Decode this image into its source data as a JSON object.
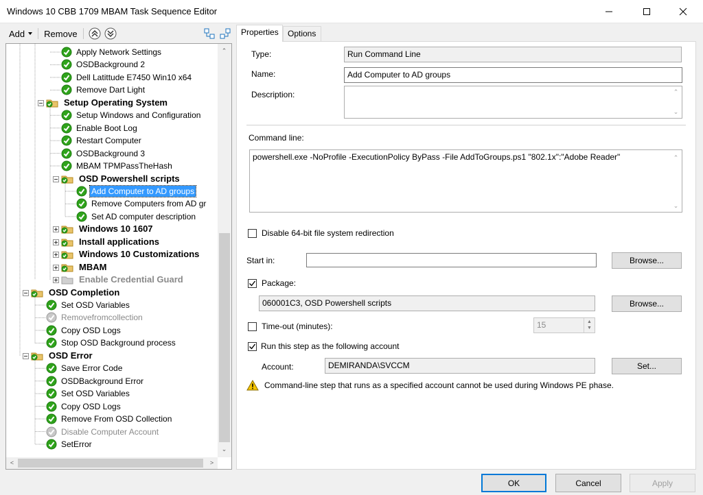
{
  "window": {
    "title": "Windows 10 CBB 1709 MBAM Task Sequence Editor"
  },
  "toolbar": {
    "add_label": "Add",
    "remove_label": "Remove"
  },
  "tree": {
    "items": [
      {
        "label": "Apply Network Settings",
        "type": "step",
        "status": "ok"
      },
      {
        "label": "OSDBackground 2",
        "type": "step",
        "status": "ok"
      },
      {
        "label": "Dell Latittude E7450 Win10 x64",
        "type": "step",
        "status": "ok"
      },
      {
        "label": "Remove Dart Light",
        "type": "step",
        "status": "ok"
      },
      {
        "label": "Setup Operating System",
        "type": "group",
        "status": "ok"
      },
      {
        "label": "Setup Windows and Configuration",
        "type": "step",
        "status": "ok"
      },
      {
        "label": "Enable Boot Log",
        "type": "step",
        "status": "ok"
      },
      {
        "label": "Restart Computer",
        "type": "step",
        "status": "ok"
      },
      {
        "label": "OSDBackground 3",
        "type": "step",
        "status": "ok"
      },
      {
        "label": "MBAM TPMPassTheHash",
        "type": "step",
        "status": "ok"
      },
      {
        "label": "OSD Powershell scripts",
        "type": "group",
        "status": "ok"
      },
      {
        "label": "Add Computer to AD groups",
        "type": "step",
        "status": "ok",
        "selected": true
      },
      {
        "label": "Remove Computers from AD gr",
        "type": "step",
        "status": "ok"
      },
      {
        "label": "Set AD computer description",
        "type": "step",
        "status": "ok"
      },
      {
        "label": "Windows 10 1607",
        "type": "group",
        "status": "ok"
      },
      {
        "label": "Install applications",
        "type": "group",
        "status": "ok"
      },
      {
        "label": "Windows 10 Customizations",
        "type": "group",
        "status": "ok"
      },
      {
        "label": "MBAM",
        "type": "group",
        "status": "ok"
      },
      {
        "label": "Enable Credential Guard",
        "type": "group",
        "status": "disabled"
      },
      {
        "label": "OSD Completion",
        "type": "group",
        "status": "ok"
      },
      {
        "label": "Set OSD Variables",
        "type": "step",
        "status": "ok"
      },
      {
        "label": "Removefromcollection",
        "type": "step",
        "status": "disabled"
      },
      {
        "label": "Copy OSD Logs",
        "type": "step",
        "status": "ok"
      },
      {
        "label": "Stop OSD Background process",
        "type": "step",
        "status": "ok"
      },
      {
        "label": "OSD Error",
        "type": "group",
        "status": "ok"
      },
      {
        "label": "Save Error Code",
        "type": "step",
        "status": "ok"
      },
      {
        "label": "OSDBackground Error",
        "type": "step",
        "status": "ok"
      },
      {
        "label": "Set OSD Variables",
        "type": "step",
        "status": "ok"
      },
      {
        "label": "Copy OSD Logs",
        "type": "step",
        "status": "ok"
      },
      {
        "label": "Remove From OSD Collection",
        "type": "step",
        "status": "ok"
      },
      {
        "label": "Disable Computer Account",
        "type": "step",
        "status": "disabled"
      },
      {
        "label": "SetError",
        "type": "step",
        "status": "ok"
      }
    ]
  },
  "tabs": {
    "properties": "Properties",
    "options": "Options"
  },
  "properties": {
    "type_label": "Type:",
    "type_value": "Run Command Line",
    "name_label": "Name:",
    "name_value": "Add Computer to AD groups",
    "description_label": "Description:",
    "description_value": "",
    "command_line_label": "Command line:",
    "command_line_value": "powershell.exe -NoProfile -ExecutionPolicy ByPass -File AddToGroups.ps1 \"802.1x\":\"Adobe Reader\"",
    "disable64_label": "Disable 64-bit file system redirection",
    "disable64_checked": false,
    "start_in_label": "Start in:",
    "start_in_value": "",
    "browse_label": "Browse...",
    "package_label": "Package:",
    "package_checked": true,
    "package_value": "060001C3, OSD Powershell scripts",
    "timeout_label": "Time-out (minutes):",
    "timeout_checked": false,
    "timeout_value": "15",
    "run_as_label": "Run this step as the following account",
    "run_as_checked": true,
    "account_label": "Account:",
    "account_value": "DEMIRANDA\\SVCCM",
    "set_label": "Set...",
    "warning_text": "Command-line step that runs as a specified account cannot be used during Windows PE phase."
  },
  "footer": {
    "ok_label": "OK",
    "cancel_label": "Cancel",
    "apply_label": "Apply"
  },
  "colors": {
    "accent": "#0078d7",
    "selection": "#3399ff",
    "ok_green": "#2fa31b",
    "folder": "#e9c46a"
  }
}
